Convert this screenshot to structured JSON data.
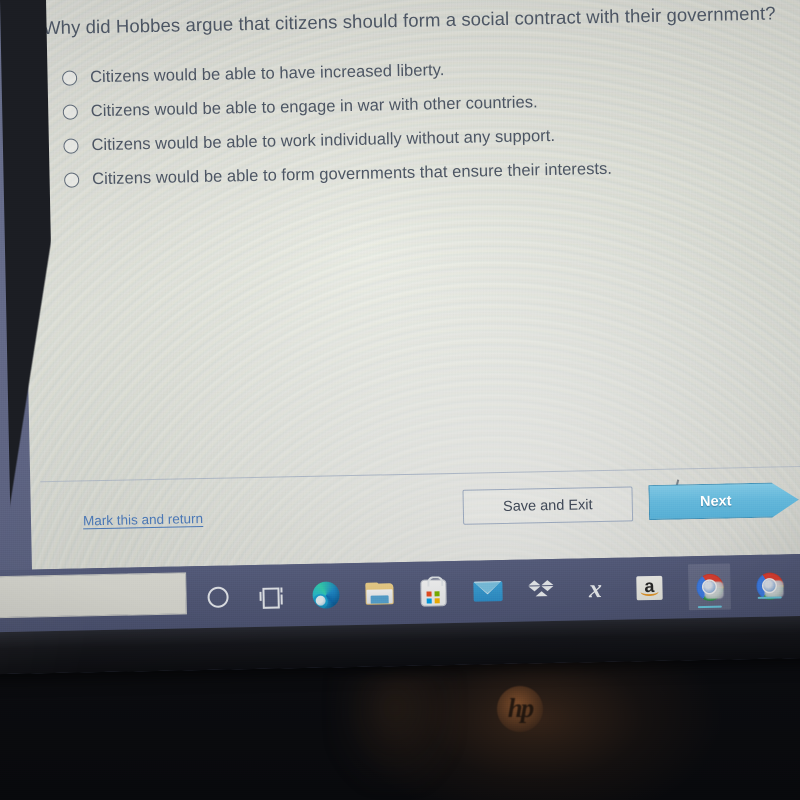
{
  "quiz": {
    "question": "Why did Hobbes argue that citizens should form a social contract with their government?",
    "options": [
      {
        "id": "a",
        "label": "Citizens would be able to have increased liberty.",
        "selected": false
      },
      {
        "id": "b",
        "label": "Citizens would be able to engage in war with other countries.",
        "selected": false
      },
      {
        "id": "c",
        "label": "Citizens would be able to work individually without any support.",
        "selected": false
      },
      {
        "id": "d",
        "label": "Citizens would be able to form governments that ensure their interests.",
        "selected": false
      }
    ],
    "footer": {
      "mark_link": "Mark this and return",
      "save_exit_label": "Save and Exit",
      "next_label": "Next"
    },
    "colors": {
      "text": "#4c5563",
      "link": "#4a77b5",
      "next_button": "#64b7da",
      "next_button_border": "#3f8fb5",
      "page_background": "#e7e9e1",
      "radio_border": "#5d6876"
    }
  },
  "taskbar": {
    "search_box": {
      "value": "",
      "placeholder": ""
    },
    "icons": [
      {
        "name": "cortana-icon",
        "title": "Cortana",
        "state": "idle"
      },
      {
        "name": "task-view-icon",
        "title": "Task View",
        "state": "idle"
      },
      {
        "name": "microsoft-edge-icon",
        "title": "Microsoft Edge",
        "state": "idle"
      },
      {
        "name": "file-explorer-icon",
        "title": "File Explorer",
        "state": "idle"
      },
      {
        "name": "microsoft-store-icon",
        "title": "Microsoft Store",
        "state": "idle"
      },
      {
        "name": "mail-icon",
        "title": "Mail",
        "state": "idle"
      },
      {
        "name": "dropbox-icon",
        "title": "Dropbox",
        "state": "idle"
      },
      {
        "name": "bolt-icon",
        "title": "S",
        "state": "idle"
      },
      {
        "name": "amazon-icon",
        "title": "Amazon",
        "state": "idle"
      },
      {
        "name": "google-chrome-icon",
        "title": "Google Chrome",
        "state": "active"
      },
      {
        "name": "google-chrome-icon",
        "title": "Google Chrome",
        "state": "running"
      },
      {
        "name": "microsoft-edge-icon",
        "title": "Microsoft Edge",
        "state": "idle"
      }
    ],
    "colors": {
      "background": "#555c7c",
      "running_underline": "#6fd0e8"
    }
  },
  "device": {
    "brand_logo": "hp",
    "bezel_color": "#121318",
    "desktop_background": "#636a8c"
  }
}
